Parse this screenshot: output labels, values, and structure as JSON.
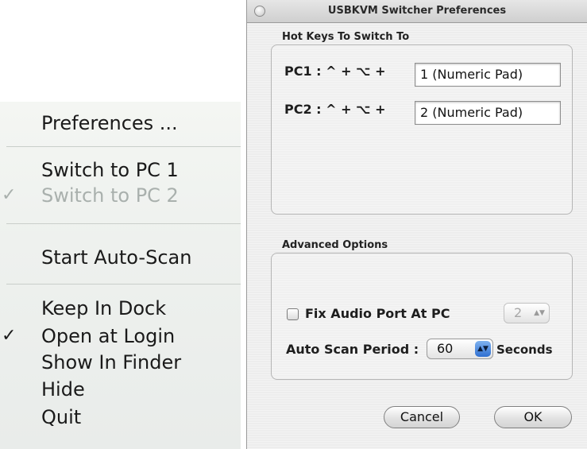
{
  "dock_menu": {
    "items": [
      {
        "label": "Preferences ...",
        "checked": false,
        "disabled": false
      },
      {
        "label": "Switch to PC 1",
        "checked": false,
        "disabled": false
      },
      {
        "label": "Switch to PC 2",
        "checked": true,
        "disabled": true
      },
      {
        "label": "Start Auto-Scan",
        "checked": false,
        "disabled": false
      },
      {
        "label": "Keep In Dock",
        "checked": false,
        "disabled": false
      },
      {
        "label": "Open at Login",
        "checked": true,
        "disabled": false
      },
      {
        "label": "Show In Finder",
        "checked": false,
        "disabled": false
      },
      {
        "label": "Hide",
        "checked": false,
        "disabled": false
      },
      {
        "label": "Quit",
        "checked": false,
        "disabled": false
      }
    ],
    "check_glyph": "✓"
  },
  "window": {
    "title": "USBKVM Switcher Preferences",
    "hotkeys": {
      "group_label": "Hot Keys To Switch To",
      "rows": [
        {
          "label": "PC1 : ^ + ⌥ +",
          "value": "1 (Numeric Pad)"
        },
        {
          "label": "PC2 : ^ + ⌥ +",
          "value": "2 (Numeric Pad)"
        }
      ]
    },
    "advanced": {
      "group_label": "Advanced Options",
      "fix_audio_label": "Fix Audio Port At PC",
      "fix_audio_checked": false,
      "fix_audio_pc": "2",
      "auto_scan_label": "Auto Scan Period :",
      "auto_scan_value": "60",
      "auto_scan_unit": "Seconds"
    },
    "buttons": {
      "cancel": "Cancel",
      "ok": "OK"
    },
    "popup_arrows": "▲▼"
  }
}
